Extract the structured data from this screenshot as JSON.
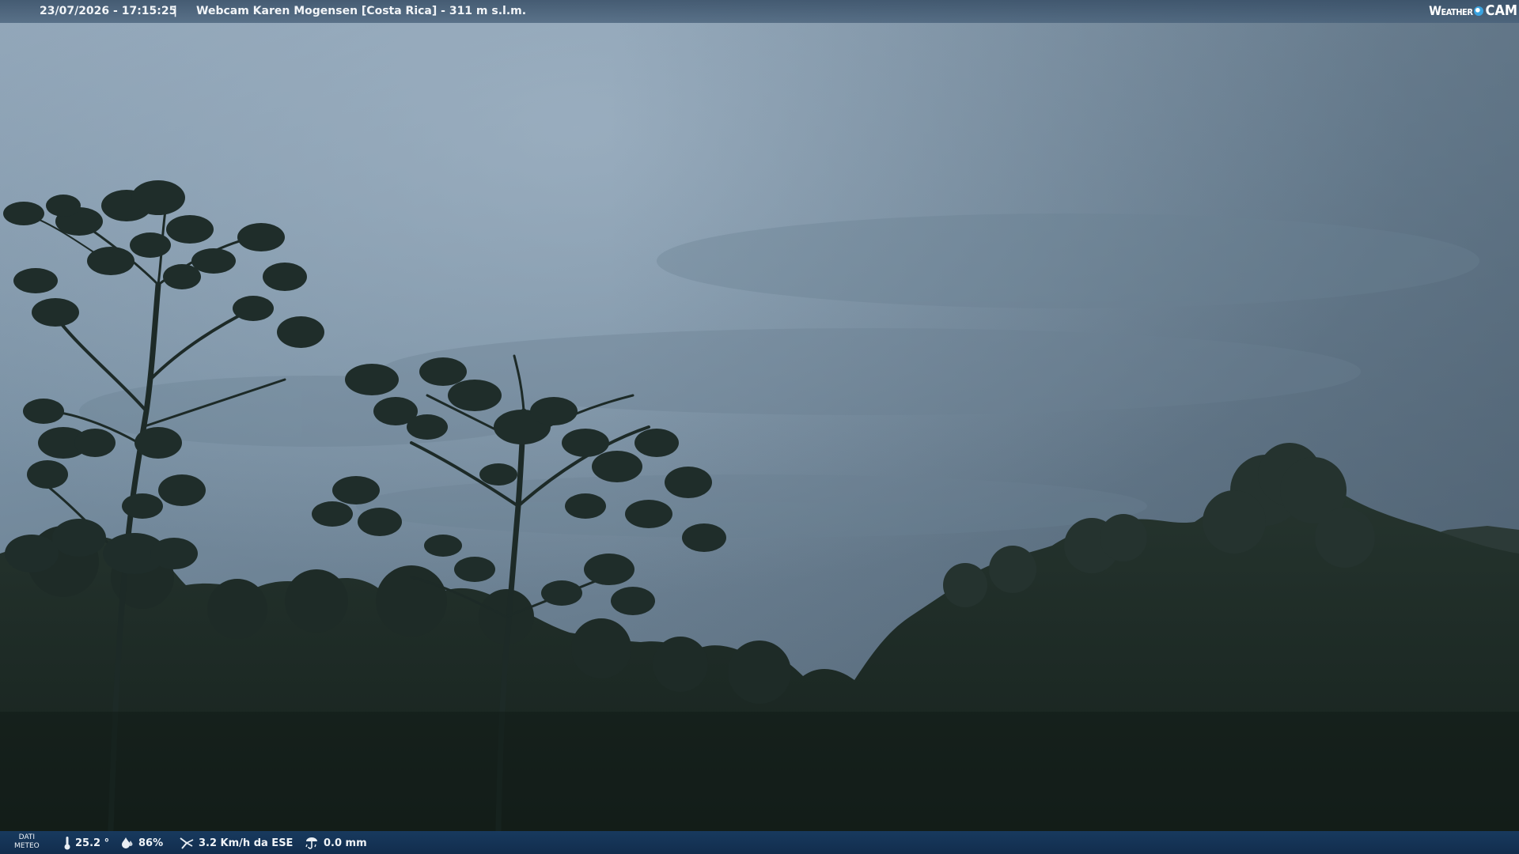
{
  "overlay": {
    "timestamp": "23/07/2026 - 17:15:25",
    "separator": "|",
    "title": "Webcam Karen Mogensen [Costa Rica]  - 311 m s.l.m.",
    "logo_left": "Weather",
    "logo_right": "CAM"
  },
  "weather": {
    "label_line1": "DATI",
    "label_line2": "METEO",
    "temperature": "25.2 °",
    "humidity": "86%",
    "wind": "3.2 Km/h da ESE",
    "rain": "0.0 mm",
    "icons": [
      "thermometer-icon",
      "humidity-drop-icon",
      "wind-icon",
      "rain-gauge-icon"
    ]
  },
  "colors": {
    "sky_top": "#8ea3b6",
    "sky_bottom": "#5d7182",
    "foliage": "#1c2a26",
    "bar_bottom": "#183c64"
  }
}
